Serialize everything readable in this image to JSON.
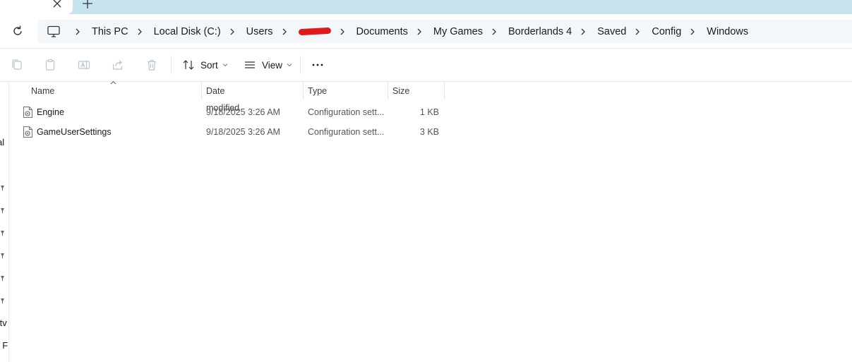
{
  "tabstrip": {
    "close_icon": "close-icon",
    "new_tab_icon": "plus-icon",
    "background": "#c7e4ee"
  },
  "address": {
    "refresh_icon": "refresh-icon",
    "computer_icon": "computer-icon",
    "crumbs": [
      "This PC",
      "Local Disk (C:)",
      "Users",
      "",
      "Documents",
      "My Games",
      "Borderlands 4",
      "Saved",
      "Config",
      "Windows"
    ],
    "redaction_color": "#e0191b"
  },
  "toolbar": {
    "icons": [
      "copy-icon",
      "paste-icon",
      "rename-icon",
      "share-icon",
      "delete-icon"
    ],
    "sort_label": "Sort",
    "view_label": "View",
    "more_label": "···"
  },
  "nav": {
    "fragments": [
      "al",
      "ftv",
      "t F"
    ]
  },
  "columns": {
    "name": "Name",
    "date": "Date modified",
    "type": "Type",
    "size": "Size"
  },
  "files": [
    {
      "name": "Engine",
      "date": "9/18/2025 3:26 AM",
      "type": "Configuration sett...",
      "size": "1 KB"
    },
    {
      "name": "GameUserSettings",
      "date": "9/18/2025 3:26 AM",
      "type": "Configuration sett...",
      "size": "3 KB"
    }
  ]
}
